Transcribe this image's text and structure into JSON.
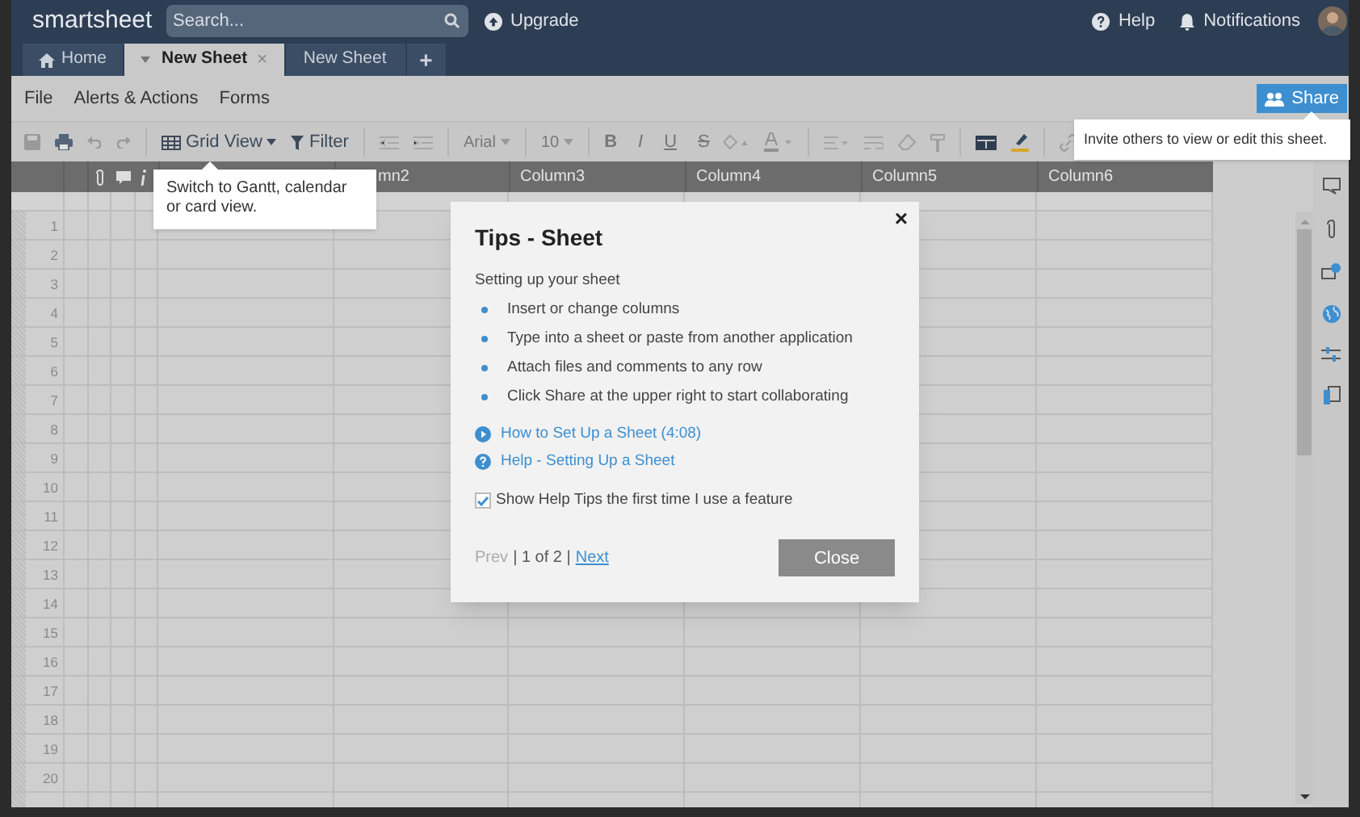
{
  "top_bar": {
    "logo": "smartsheet",
    "search": {
      "placeholder": "Search..."
    },
    "upgrade": "Upgrade",
    "help": "Help",
    "notifications": "Notifications"
  },
  "tabs": [
    {
      "kind": "home",
      "label": "Home",
      "selected": false
    },
    {
      "kind": "sheet",
      "label": "New Sheet",
      "close": "×",
      "selected": true
    },
    {
      "kind": "sheet",
      "label": "New Sheet",
      "selected": false
    },
    {
      "kind": "add",
      "label": "+",
      "selected": false
    }
  ],
  "menu": [
    "File",
    "Alerts & Actions",
    "Forms"
  ],
  "share_button": "Share",
  "share_tooltip": "Invite others to view or edit this sheet.",
  "toolbar": {
    "view": "Grid View",
    "filter": "Filter",
    "font": "Arial",
    "size": "10",
    "format": [
      "B",
      "I",
      "U",
      "S"
    ]
  },
  "view_tooltip": "Switch to Gantt, calendar or card view.",
  "grid": {
    "columns": [
      "",
      "mn2",
      "Column3",
      "Column4",
      "Column5",
      "Column6"
    ],
    "rows": [
      "1",
      "2",
      "3",
      "4",
      "5",
      "6",
      "7",
      "8",
      "9",
      "10",
      "11",
      "12",
      "13",
      "14",
      "15",
      "16",
      "17",
      "18",
      "19",
      "20"
    ]
  },
  "dialog": {
    "close": "×",
    "title": "Tips - Sheet",
    "subtitle": "Setting up your sheet",
    "bullets": [
      "Insert or change columns",
      "Type into a sheet or paste from another application",
      "Attach files and comments to any row",
      "Click Share at the upper right to start collaborating"
    ],
    "links": [
      {
        "kind": "video",
        "label": "How to Set Up a Sheet (4:08)"
      },
      {
        "kind": "help",
        "label": "Help - Setting Up a Sheet"
      }
    ],
    "checkbox": {
      "label": "Show Help Tips the first time I use a feature",
      "checked": true
    },
    "pager": {
      "prev": "Prev",
      "position": "| 1 of 2 |",
      "next": "Next",
      "prev_disabled": true
    },
    "button": "Close"
  }
}
